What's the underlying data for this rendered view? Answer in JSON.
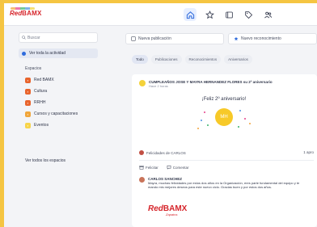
{
  "app": {
    "logo_red": "Red",
    "logo_bamx": "BAMX"
  },
  "nav": {
    "icons": [
      "home-icon",
      "star-icon",
      "square-icon",
      "tag-icon",
      "people-icon"
    ]
  },
  "sidebar": {
    "search_placeholder": "Buscar",
    "activity_label": "Ver toda la actividad",
    "section_title": "Espacios",
    "spaces": [
      {
        "label": "Red BAMX",
        "color": "#e8642c"
      },
      {
        "label": "Cultura",
        "color": "#e8642c"
      },
      {
        "label": "RRHH",
        "color": "#e8642c"
      },
      {
        "label": "Cursos y capacitaciones",
        "color": "#f0a53a"
      },
      {
        "label": "Eventos",
        "color": "#f7d44a"
      }
    ],
    "see_all": "Ver todos los espacios"
  },
  "main": {
    "new_post": "Nueva publicación",
    "new_recognition": "Nuevo reconocimiento",
    "filters": [
      "Todo",
      "Publicaciones",
      "Reconocimientos",
      "Aniversarios"
    ],
    "active_filter": "Todo",
    "post": {
      "title": "CUMPLEAÑOS JOSE Y MAYRA HERNANDEZ FLORES su 2º aniversario",
      "subtitle": "Hace 2 horas",
      "anniversary_text": "¡Feliz 2º aniversario!",
      "avatar_initials": "MH",
      "reaction_text": "Felicidades de CARLOS",
      "reaction_right": "1 apro",
      "action_congrats": "Felicitar",
      "action_comment": "Comentar",
      "comment_name": "CARLOS SANCHEZ",
      "comment_text": "Mayra, muchas felicidades por estos dos años en la Organización, eres parte fundamental del equipo y te mando mis mejores deseos para este nuevo ciclo. Gracias buen y por estos dos años.",
      "comment_logo_red": "Red",
      "comment_logo_bamx": "BAMX",
      "comment_logo_sub": "Zapatos"
    }
  }
}
